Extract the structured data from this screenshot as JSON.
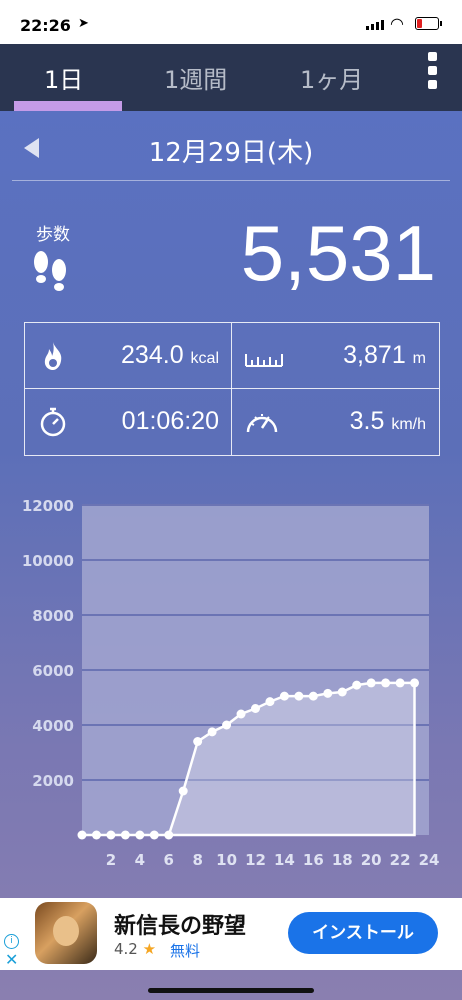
{
  "status": {
    "time": "22:26"
  },
  "tabs": [
    {
      "label": "1日",
      "active": true
    },
    {
      "label": "1週間",
      "active": false
    },
    {
      "label": "1ヶ月",
      "active": false
    }
  ],
  "date": "12月29日(木)",
  "steps": {
    "label": "歩数",
    "value": "5,531"
  },
  "stats": {
    "calories": {
      "value": "234.0",
      "unit": "kcal",
      "icon": "flame-icon"
    },
    "distance": {
      "value": "3,871",
      "unit": "m",
      "icon": "ruler-icon"
    },
    "duration": {
      "value": "01:06:20",
      "icon": "stopwatch-icon"
    },
    "speed": {
      "value": "3.5",
      "unit": "km/h",
      "icon": "speedometer-icon"
    }
  },
  "chart_data": {
    "type": "area",
    "x_ticks": [
      "2",
      "4",
      "6",
      "8",
      "10",
      "12",
      "14",
      "16",
      "18",
      "20",
      "22",
      "24"
    ],
    "y_ticks": [
      "2000",
      "4000",
      "6000",
      "8000",
      "10000",
      "12000"
    ],
    "ylim": [
      0,
      12000
    ],
    "xlim": [
      0,
      24
    ],
    "grid": true,
    "x": [
      0,
      1,
      2,
      3,
      4,
      5,
      6,
      7,
      8,
      9,
      10,
      11,
      12,
      13,
      14,
      15,
      16,
      17,
      18,
      19,
      20,
      21,
      22,
      23
    ],
    "values": [
      0,
      0,
      0,
      0,
      0,
      0,
      0,
      1600,
      3400,
      3750,
      4000,
      4400,
      4600,
      4850,
      5050,
      5050,
      5050,
      5150,
      5200,
      5450,
      5531,
      5531,
      5531,
      5531
    ],
    "colors": {
      "line": "#ffffff",
      "plot_bg": "#a2a6d0",
      "grid": "#6b74b4"
    }
  },
  "ad": {
    "title": "新信長の野望",
    "rating": "4.2",
    "price": "無料",
    "install_label": "インストール"
  }
}
